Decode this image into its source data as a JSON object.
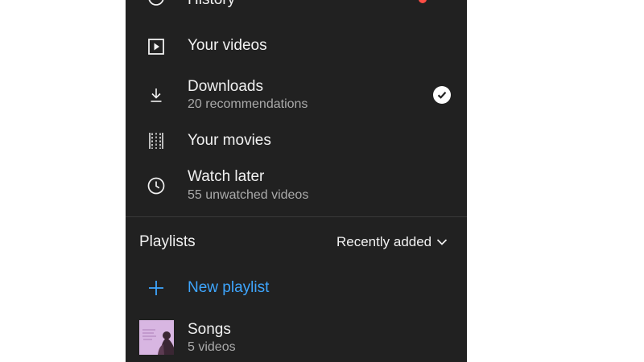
{
  "library": {
    "partial_item": {
      "label": "History",
      "icon": "history-icon"
    },
    "items": [
      {
        "label": "Your videos",
        "sub": "",
        "icon": "play-box-icon"
      },
      {
        "label": "Downloads",
        "sub": "20 recommendations",
        "icon": "download-icon",
        "checked": true
      },
      {
        "label": "Your movies",
        "sub": "",
        "icon": "film-icon"
      },
      {
        "label": "Watch later",
        "sub": "55 unwatched videos",
        "icon": "clock-icon"
      }
    ]
  },
  "playlists": {
    "heading": "Playlists",
    "sort_label": "Recently added",
    "new_label": "New playlist",
    "items": [
      {
        "label": "Songs",
        "sub": "5 videos"
      }
    ]
  },
  "colors": {
    "background": "#212121",
    "accent_blue": "#3ea6ff",
    "text_primary": "#f1f1f1",
    "text_secondary": "#aaaaaa"
  }
}
